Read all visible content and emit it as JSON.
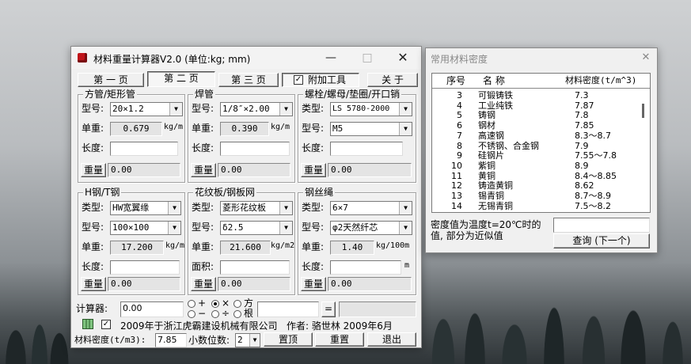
{
  "main_window": {
    "title": "材料重量计算器V2.0 (单位:kg; mm)",
    "tabs": [
      "第 一 页",
      "第 二 页",
      "第 三 页"
    ],
    "addon_checkbox_label": "附加工具",
    "about_button": "关  于",
    "labels": {
      "model": "型号:",
      "type": "类型:",
      "unit_weight": "单重:",
      "length": "长度:",
      "area": "面积:",
      "weight_button": "重量"
    },
    "groups": {
      "square_tube": {
        "title": "方管/矩形管",
        "model": "20×1.2",
        "unit_weight": "0.679",
        "unit": "kg/m",
        "length": "",
        "weight": "0.00"
      },
      "welded_pipe": {
        "title": "焊管",
        "model": "1/8″×2.00",
        "unit_weight": "0.390",
        "unit": "kg/m",
        "length": "",
        "weight": "0.00"
      },
      "bolt": {
        "title": "螺栓/螺母/垫圈/开口销",
        "type": "LS 5780-2000",
        "model": "M5",
        "length": "",
        "weight": "0.00"
      },
      "h_steel": {
        "title": "H钢/T钢",
        "type": "HW宽翼缘",
        "model": "100×100",
        "unit_weight": "17.200",
        "unit": "kg/m",
        "length": "",
        "weight": "0.00"
      },
      "pattern_plate": {
        "title": "花纹板/钢板网",
        "type": "菱形花纹板",
        "model": "δ2.5",
        "unit_weight": "21.600",
        "unit": "kg/m2",
        "area": "",
        "weight": "0.00"
      },
      "wire_rope": {
        "title": "钢丝绳",
        "type": "6×7",
        "model": "φ2天然纤芯",
        "unit_weight": "1.40",
        "unit": "kg/100m",
        "length_unit": "m",
        "length": "",
        "weight": "0.00"
      }
    },
    "calculator": {
      "label": "计算器:",
      "value": "0.00",
      "ops": [
        "+",
        "×",
        "方",
        "−",
        "÷",
        "根"
      ],
      "equals": "=",
      "output": ""
    },
    "footer": {
      "company": "2009年于浙江虎霸建设机械有限公司",
      "author": "作者: 骆世林  2009年6月",
      "density_label": "材料密度(t/m3):",
      "density_value": "7.85",
      "decimals_label": "小数位数:",
      "decimals_value": "2",
      "top_button": "置顶",
      "reset_button": "重置",
      "exit_button": "退出"
    }
  },
  "density_window": {
    "title": "常用材料密度",
    "headers": [
      "序号",
      "名  称",
      "材料密度(t/m^3)"
    ],
    "rows": [
      {
        "no": "3",
        "name": "可锻铸铁",
        "density": "7.3"
      },
      {
        "no": "4",
        "name": "工业纯铁",
        "density": "7.87"
      },
      {
        "no": "5",
        "name": "铸钢",
        "density": "7.8"
      },
      {
        "no": "6",
        "name": "钢材",
        "density": "7.85"
      },
      {
        "no": "7",
        "name": "高速钢",
        "density": "8.3～8.7"
      },
      {
        "no": "8",
        "name": "不锈钢、合金钢",
        "density": "7.9"
      },
      {
        "no": "9",
        "name": "硅钢片",
        "density": "7.55～7.8"
      },
      {
        "no": "10",
        "name": "紫铜",
        "density": "8.9"
      },
      {
        "no": "11",
        "name": "黄铜",
        "density": "8.4～8.85"
      },
      {
        "no": "12",
        "name": "铸造黄铜",
        "density": "8.62"
      },
      {
        "no": "13",
        "name": "锡青铜",
        "density": "8.7～8.9"
      },
      {
        "no": "14",
        "name": "无锡青铜",
        "density": "7.5～8.2"
      }
    ],
    "note": "密度值为温度t=20℃时的值, 部分为近似值",
    "search_value": "",
    "query_button": "查询 (下一个)"
  }
}
